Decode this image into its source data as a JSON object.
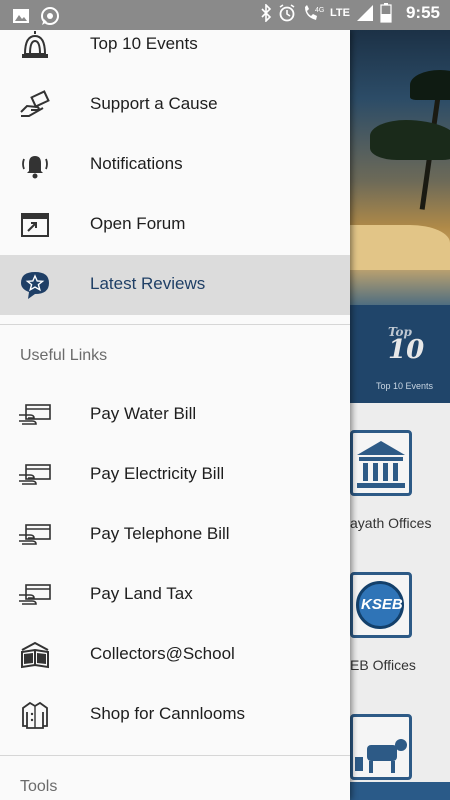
{
  "status_bar": {
    "time": "9:55",
    "network": "LTE",
    "data_label": "4G",
    "icons_left": [
      "image-icon",
      "whatsapp-icon"
    ],
    "icons_right": [
      "bluetooth-icon",
      "alarm-icon",
      "wifi-call-icon",
      "signal-icon",
      "battery-icon"
    ]
  },
  "drawer": {
    "items": [
      {
        "label": "Top 10 Events",
        "icon": "siren-icon"
      },
      {
        "label": "Support a Cause",
        "icon": "donate-hand-icon"
      },
      {
        "label": "Notifications",
        "icon": "bell-icon"
      },
      {
        "label": "Open Forum",
        "icon": "forum-window-icon"
      },
      {
        "label": "Latest Reviews",
        "icon": "star-chat-icon",
        "active": true
      }
    ],
    "useful_links": {
      "header": "Useful Links",
      "items": [
        {
          "label": "Pay Water Bill",
          "icon": "card-pay-icon"
        },
        {
          "label": "Pay Electricity Bill",
          "icon": "card-pay-icon"
        },
        {
          "label": "Pay Telephone Bill",
          "icon": "card-pay-icon"
        },
        {
          "label": "Pay Land Tax",
          "icon": "card-pay-icon"
        },
        {
          "label": "Collectors@School",
          "icon": "school-book-icon"
        },
        {
          "label": "Shop for Cannlooms",
          "icon": "shirt-icon"
        }
      ]
    },
    "tools": {
      "header": "Tools"
    }
  },
  "background": {
    "top10_small": "Top",
    "top10_big": "10",
    "top10_label": "Top 10 Events",
    "card1_label": "ayath Offices",
    "card2_label": "EB Offices",
    "kseb_logo": "KSEB"
  },
  "colors": {
    "accent": "#1f3f66",
    "active_bg": "#dcdcdc",
    "statusbar": "#8a8a8a",
    "bg_primary": "#2d5a86"
  }
}
